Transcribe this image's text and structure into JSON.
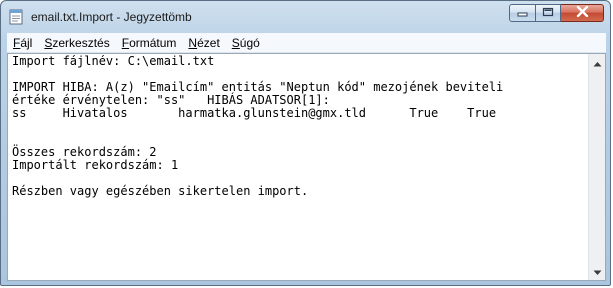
{
  "window": {
    "title": "email.txt.Import - Jegyzettömb",
    "app_icon": "notepad-icon",
    "buttons": {
      "minimize_icon": "minimize-icon",
      "maximize_icon": "maximize-icon",
      "close_icon": "close-icon"
    },
    "accent": "#c44a31"
  },
  "menu": [
    {
      "hotkey": "F",
      "rest": "ájl"
    },
    {
      "hotkey": "S",
      "rest": "zerkesztés"
    },
    {
      "hotkey": "F",
      "rest": "ormátum"
    },
    {
      "hotkey": "N",
      "rest": "ézet"
    },
    {
      "hotkey": "S",
      "rest": "úgó"
    }
  ],
  "document": {
    "lines": [
      "Import fájlnév: C:\\email.txt",
      "",
      "IMPORT HIBA: A(z) \"Emailcím\" entitás \"Neptun kód\" mezojének beviteli",
      "értéke érvénytelen: \"ss\"   HIBÁS ADATSOR[1]:",
      "ss     Hivatalos       harmatka.glunstein@gmx.tld      True    True",
      "",
      "",
      "Összes rekordszám: 2",
      "Importált rekordszám: 1",
      "",
      "Részben vagy egészében sikertelen import."
    ]
  },
  "scrollbar": {
    "up_icon": "scroll-up-arrow-icon",
    "down_icon": "scroll-down-arrow-icon"
  }
}
